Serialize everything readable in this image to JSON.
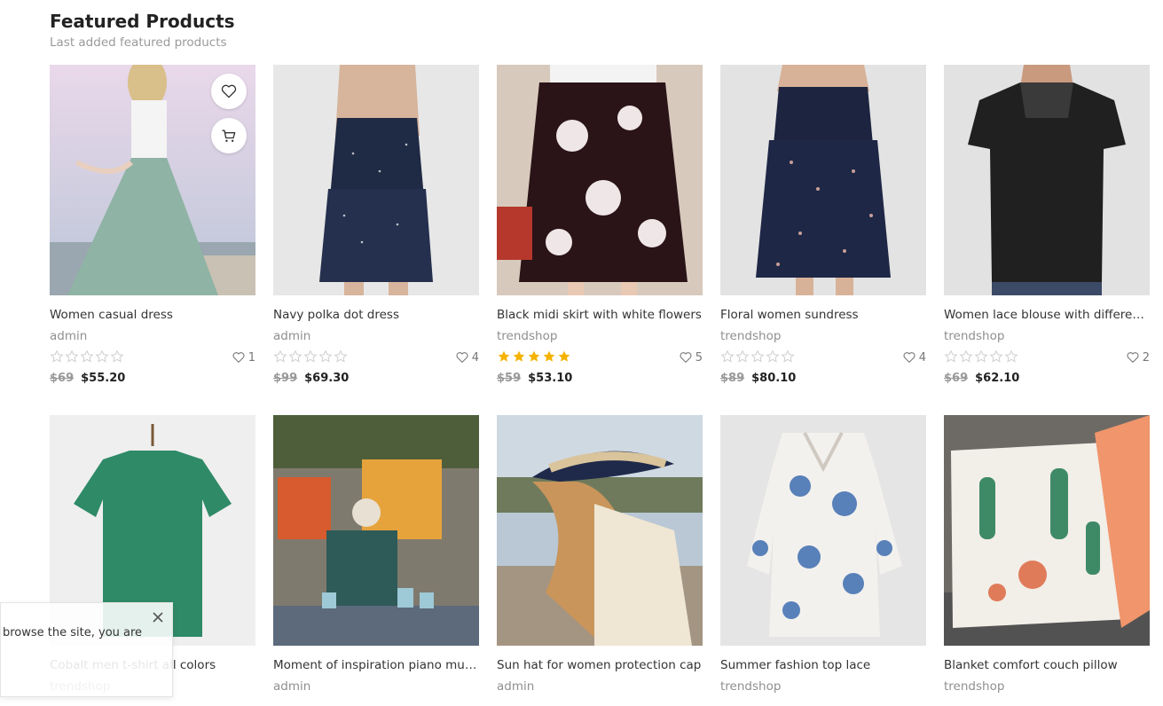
{
  "section": {
    "title": "Featured Products",
    "subtitle": "Last added featured products"
  },
  "products": [
    {
      "name": "Women casual dress",
      "vendor": "admin",
      "rating": 0,
      "wishes": "1",
      "old_price": "$69",
      "price": "$55.20"
    },
    {
      "name": "Navy polka dot dress",
      "vendor": "admin",
      "rating": 0,
      "wishes": "4",
      "old_price": "$99",
      "price": "$69.30"
    },
    {
      "name": "Black midi skirt with white flowers",
      "vendor": "trendshop",
      "rating": 5,
      "wishes": "5",
      "old_price": "$59",
      "price": "$53.10"
    },
    {
      "name": "Floral women sundress",
      "vendor": "trendshop",
      "rating": 0,
      "wishes": "4",
      "old_price": "$89",
      "price": "$80.10"
    },
    {
      "name": "Women lace blouse with different patterns",
      "vendor": "trendshop",
      "rating": 0,
      "wishes": "2",
      "old_price": "$69",
      "price": "$62.10"
    },
    {
      "name": "Cobalt men t-shirt all colors",
      "vendor": "trendshop"
    },
    {
      "name": "Moment of inspiration piano music",
      "vendor": "admin"
    },
    {
      "name": "Sun hat for women protection cap",
      "vendor": "admin"
    },
    {
      "name": "Summer fashion top lace",
      "vendor": "trendshop"
    },
    {
      "name": "Blanket comfort couch pillow",
      "vendor": "trendshop"
    }
  ],
  "cookie_notice": {
    "text": "browse the site, you are"
  },
  "colors": {
    "star_filled": "#f5b301",
    "star_empty": "#cfcfcf",
    "title": "#222222",
    "muted": "#8f8f8f"
  },
  "icons": {
    "wishlist": "heart-icon",
    "cart": "cart-icon",
    "close": "close-icon",
    "rating": "star-icon"
  }
}
